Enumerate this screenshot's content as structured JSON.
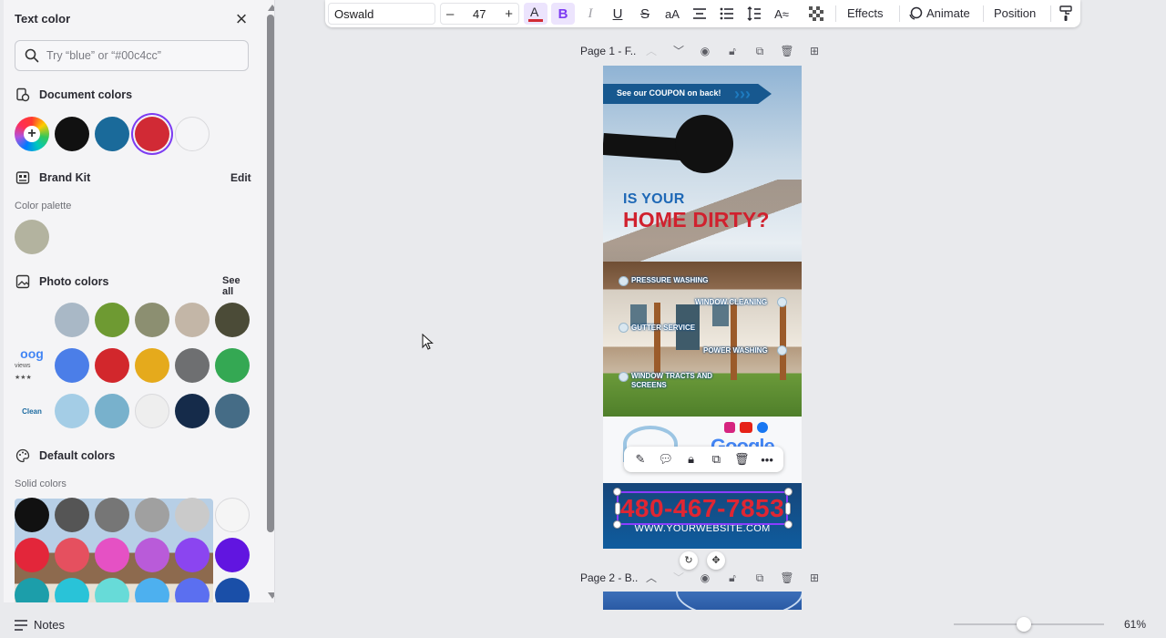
{
  "panel": {
    "title": "Text color",
    "search_placeholder": "Try “blue” or “#00c4cc”",
    "document_colors": {
      "label": "Document colors",
      "colors": [
        "#111111",
        "#1a6a9a",
        "#d12a35",
        "#f5f5f7"
      ],
      "selected": "#d12a35"
    },
    "brand_kit": {
      "label": "Brand Kit",
      "edit_label": "Edit",
      "palette_label": "Color palette",
      "colors": [
        "#b3b39f"
      ]
    },
    "photo_colors": {
      "label": "Photo colors",
      "see_all_label": "See all",
      "rows": [
        {
          "thumb": "house-photo",
          "colors": [
            "#a9b8c6",
            "#6e9a32",
            "#8c8f71",
            "#c3b6a7",
            "#4b4b37"
          ]
        },
        {
          "thumb": "google-reviews-logo",
          "thumb_text": "oog",
          "thumb_sub": "views ★★★",
          "colors": [
            "#4b7ee8",
            "#d2272c",
            "#e5aa1c",
            "#6e6f71",
            "#34a853"
          ]
        },
        {
          "thumb": "clean-logo",
          "thumb_text": "Clean",
          "colors": [
            "#a4cde6",
            "#78b1cc",
            "#eeeeee",
            "#152b4a",
            "#456c86"
          ]
        }
      ]
    },
    "default_colors": {
      "label": "Default colors",
      "solid_label": "Solid colors",
      "rows": [
        [
          "#111111",
          "#555555",
          "#767676",
          "#a0a0a0",
          "#cacaca",
          "#f5f5f5"
        ],
        [
          "#e3263a",
          "#e5505f",
          "#e551c4",
          "#b95bd9",
          "#8b45f0",
          "#6115e0"
        ],
        [
          "#1c9eaa",
          "#29c3d8",
          "#67dbd8",
          "#4db0ef",
          "#5b6ff0",
          "#1a4fa8"
        ]
      ]
    }
  },
  "toolbar": {
    "font": "Oswald",
    "font_size": "47",
    "effects_label": "Effects",
    "animate_label": "Animate",
    "position_label": "Position"
  },
  "pages": [
    {
      "label": "Page 1 - F.."
    },
    {
      "label": "Page 2 - B.."
    }
  ],
  "design": {
    "coupon_text": "See our COUPON on back!",
    "headline_1": "IS YOUR",
    "headline_2": "HOME DIRTY?",
    "services": [
      "PRESSURE WASHING",
      "WINDOW CLEANING",
      "GUTTER SERVICE",
      "POWER WASHING",
      "WINDOW TRACTS AND SCREENS"
    ],
    "phone": "480-467-7853",
    "website": "WWW.YOURWEBSITE.COM",
    "brand_text": "Google"
  },
  "bottom": {
    "notes_label": "Notes",
    "zoom": "61%",
    "zoom_fraction": 0.46
  }
}
